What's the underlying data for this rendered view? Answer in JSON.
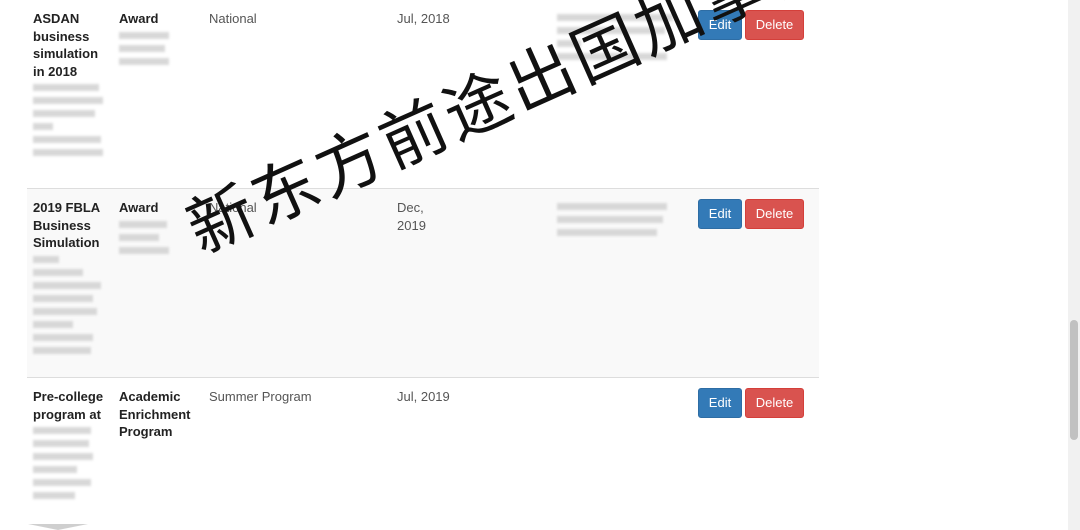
{
  "rows": [
    {
      "name": "ASDAN business simulation in 2018",
      "type": "Award",
      "level": "National",
      "date": "Jul, 2018",
      "edit_label": "Edit",
      "delete_label": "Delete"
    },
    {
      "name": "2019 FBLA Business Simulation",
      "type": "Award",
      "level": "National",
      "date": "Dec, 2019",
      "edit_label": "Edit",
      "delete_label": "Delete"
    },
    {
      "name": "Pre-college program at",
      "type": "Academic Enrichment Program",
      "level": "Summer Program",
      "date": "Jul, 2019",
      "edit_label": "Edit",
      "delete_label": "Delete"
    }
  ],
  "watermark": "新东方前途出国加拿大",
  "colors": {
    "edit": "#337ab7",
    "delete": "#d9534f",
    "alt_row": "#f9f9f9"
  }
}
